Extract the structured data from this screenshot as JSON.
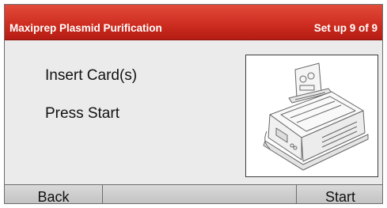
{
  "header": {
    "title": "Maxiprep Plasmid Purification",
    "step_indicator": "Set up 9 of 9"
  },
  "instructions": [
    {
      "text": "Insert Card(s)"
    },
    {
      "text": "Press Start"
    }
  ],
  "illustration": {
    "icon": "instrument-with-card-icon"
  },
  "footer": {
    "back_label": "Back",
    "middle_label": "",
    "start_label": "Start"
  },
  "colors": {
    "title_bar": "#cf2e21",
    "background": "#ebebeb",
    "button_bar": "#cccccc"
  }
}
